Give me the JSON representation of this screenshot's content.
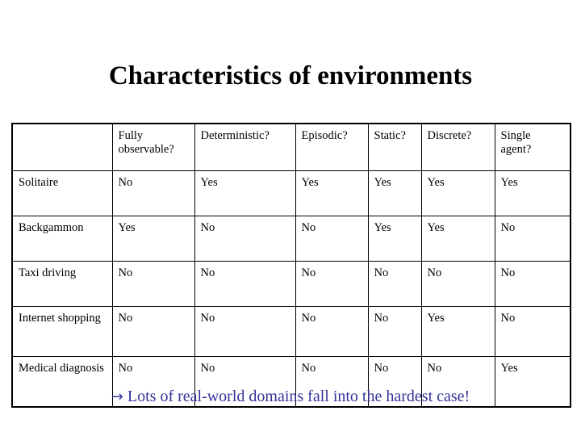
{
  "slide": {
    "title": "Characteristics of environments",
    "footer": {
      "arrow": "→",
      "text": "Lots of real-world domains fall into the hardest case!"
    },
    "accent_color": "#333399",
    "text_color": "#000000",
    "background_color": "#ffffff"
  },
  "table": {
    "corner_header": "",
    "columns": [
      "Fully observable?",
      "Deterministic?",
      "Episodic?",
      "Static?",
      "Discrete?",
      "Single agent?"
    ],
    "rows": [
      {
        "label": "Solitaire",
        "highlight": false,
        "values": [
          "No",
          "Yes",
          "Yes",
          "Yes",
          "Yes",
          "Yes"
        ]
      },
      {
        "label": "Backgammon",
        "highlight": false,
        "values": [
          "Yes",
          "No",
          "No",
          "Yes",
          "Yes",
          "No"
        ]
      },
      {
        "label": "Taxi driving",
        "highlight": false,
        "values": [
          "No",
          "No",
          "No",
          "No",
          "No",
          "No"
        ]
      },
      {
        "label": "Internet shopping",
        "highlight": false,
        "values": [
          "No",
          "No",
          "No",
          "No",
          "Yes",
          "No"
        ]
      },
      {
        "label": "Medical diagnosis",
        "highlight": true,
        "values": [
          "No",
          "No",
          "No",
          "No",
          "No",
          "Yes"
        ]
      }
    ]
  }
}
